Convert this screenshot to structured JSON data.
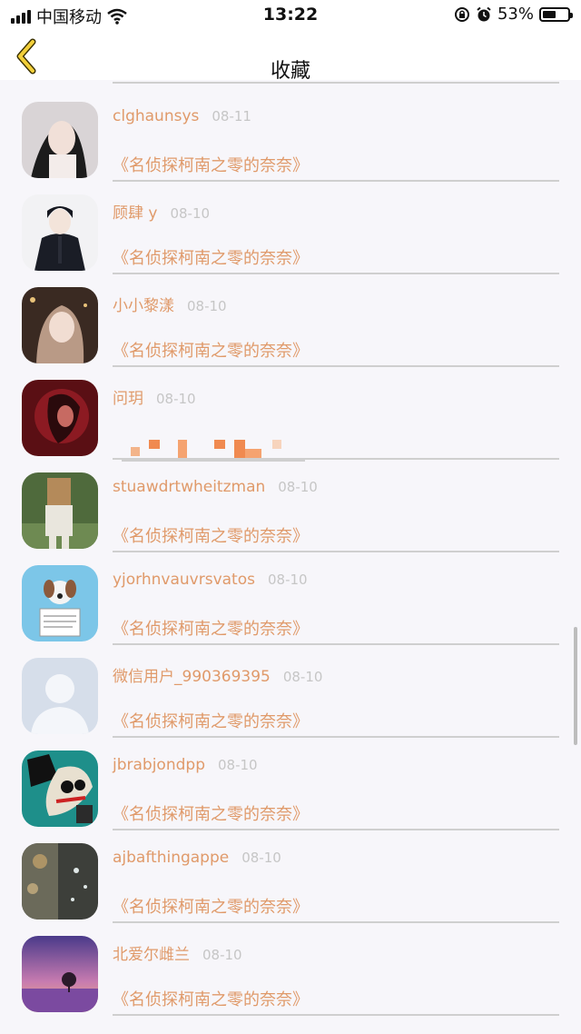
{
  "status_bar": {
    "carrier": "中国移动",
    "time": "13:22",
    "battery_percent": "53%",
    "battery_level": 0.53
  },
  "nav": {
    "title": "收藏"
  },
  "colors": {
    "accent": "#e09a6a",
    "date": "#c6c6c6",
    "divider": "#cfcfcf"
  },
  "items": [
    {
      "name": "clghaunsys",
      "date": "08-11",
      "quote": "《名侦探柯南之零的奈奈》",
      "avatar": "girl-portrait"
    },
    {
      "name": "顾肆 y",
      "date": "08-10",
      "quote": "《名侦探柯南之零的奈奈》",
      "avatar": "anime-boy-suit"
    },
    {
      "name": "小小黎漾",
      "date": "08-10",
      "quote": "《名侦探柯南之零的奈奈》",
      "avatar": "anime-girl"
    },
    {
      "name": "问玥",
      "date": "08-10",
      "quote": "",
      "avatar": "dark-red-figure"
    },
    {
      "name": "stuawdrtwheitzman",
      "date": "08-10",
      "quote": "《名侦探柯南之零的奈奈》",
      "avatar": "paper-bag-man"
    },
    {
      "name": "yjorhnvauvrsvatos",
      "date": "08-10",
      "quote": "《名侦探柯南之零的奈奈》",
      "avatar": "cartoon-dog"
    },
    {
      "name": "微信用户_990369395",
      "date": "08-10",
      "quote": "《名侦探柯南之零的奈奈》",
      "avatar": "default-user"
    },
    {
      "name": "jbrabjondpp",
      "date": "08-10",
      "quote": "《名侦探柯南之零的奈奈》",
      "avatar": "graffiti"
    },
    {
      "name": "ajbafthingappe",
      "date": "08-10",
      "quote": "《名侦探柯南之零的奈奈》",
      "avatar": "rainy-window"
    },
    {
      "name": "北爱尔雌兰",
      "date": "08-10",
      "quote": "《名侦探柯南之零的奈奈》",
      "avatar": "lavender-sunset"
    }
  ]
}
